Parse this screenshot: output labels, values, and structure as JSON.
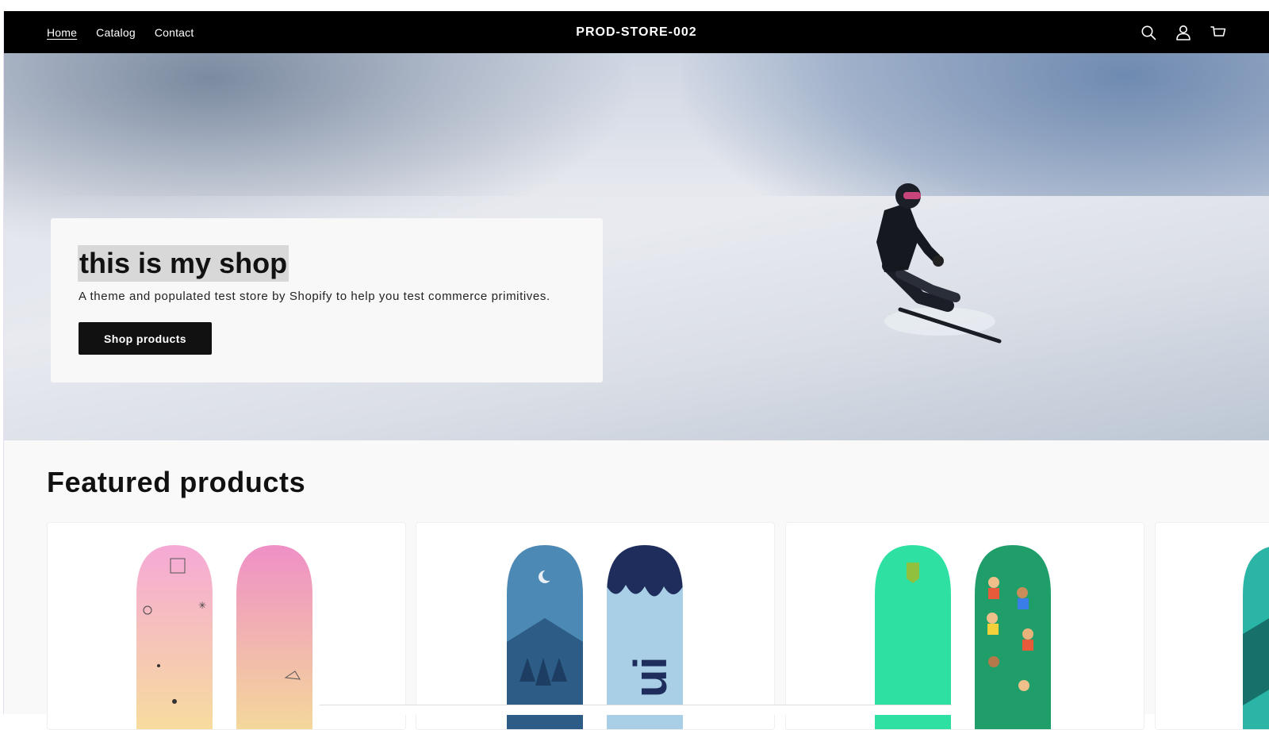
{
  "header": {
    "nav": [
      {
        "label": "Home",
        "active": true
      },
      {
        "label": "Catalog",
        "active": false
      },
      {
        "label": "Contact",
        "active": false
      }
    ],
    "brand": "PROD-STORE-002",
    "icons": [
      "search-icon",
      "account-icon",
      "cart-icon"
    ]
  },
  "hero": {
    "title": "this is my shop",
    "subtitle": "A theme and populated test store by Shopify to help you test commerce primitives.",
    "button_label": "Shop products"
  },
  "featured": {
    "title": "Featured products",
    "products": [
      {
        "image": "pink-gradient-snowboards"
      },
      {
        "image": "blue-forest-snowboards"
      },
      {
        "image": "green-shopify-snowboards"
      },
      {
        "image": "teal-snowboard-partial"
      }
    ]
  },
  "colors": {
    "header_bg": "#000000",
    "header_text": "#ffffff",
    "card_bg": "#f8f8f8",
    "button_bg": "#111111",
    "section_bg": "#f9f9f9"
  }
}
